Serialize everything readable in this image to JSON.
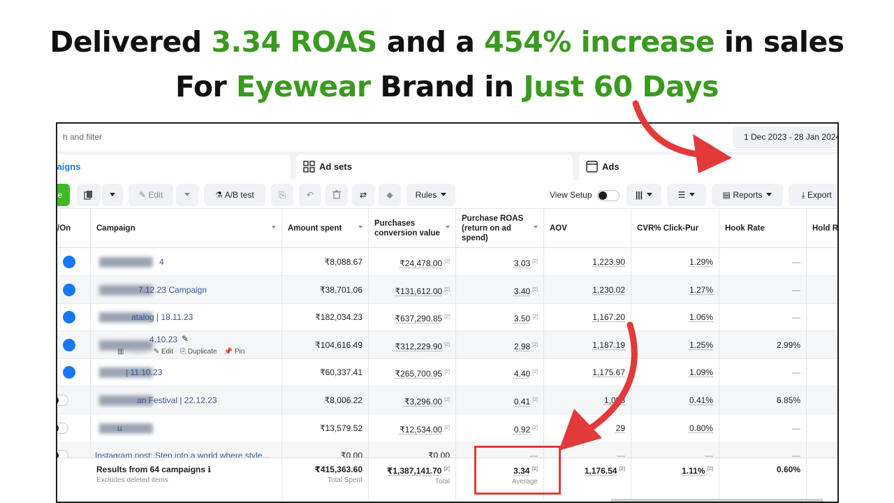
{
  "headline": {
    "line1": [
      "Delivered ",
      "3.34 ROAS",
      " and a ",
      "454% increase",
      " in sales"
    ],
    "line2": [
      "For ",
      "Eyewear",
      " Brand in ",
      "Just 60 Days"
    ]
  },
  "search": {
    "placeholder": "h and filter"
  },
  "date_range": "1 Dec 2023 - 28 Jan 2024",
  "tabs": {
    "campaigns": "mpaigns",
    "adsets": "Ad sets",
    "ads": "Ads"
  },
  "toolbar": {
    "create": "e",
    "edit": "Edit",
    "ab_test": "A/B test",
    "rules": "Rules",
    "view_setup": "View Setup",
    "reports": "Reports",
    "export": "Export"
  },
  "columns": {
    "onoff": "/On",
    "campaign": "Campaign",
    "amount_spent": "Amount spent",
    "purchases_value": "Purchases conversion value",
    "purchase_roas": "Purchase ROAS (return on ad spend)",
    "aov": "AOV",
    "cvr": "CVR% Click-Pur",
    "hook_rate": "Hook Rate",
    "hold_rate": "Hold R"
  },
  "rows": [
    {
      "on": true,
      "name": "4",
      "spent": "₹8,088.67",
      "value": "₹24,478.00",
      "roas": "3.03",
      "aov": "1,223.90",
      "cvr": "1.29%",
      "hook": "—"
    },
    {
      "on": true,
      "name": "7.12.23 Campaign",
      "spent": "₹38,701.06",
      "value": "₹131,612.00",
      "roas": "3.40",
      "aov": "1,230.02",
      "cvr": "1.27%",
      "hook": "—"
    },
    {
      "on": true,
      "name": "atalog | 18.11.23",
      "spent": "₹182,034.23",
      "value": "₹637,290.85",
      "roas": "3.50",
      "aov": "1,167.20",
      "cvr": "1.06%",
      "hook": "—"
    },
    {
      "on": true,
      "name": "4.10.23",
      "spent": "₹104,616.49",
      "value": "₹312,229.90",
      "roas": "2.98",
      "aov": "1,187.19",
      "cvr": "1.25%",
      "hook": "2.99%"
    },
    {
      "on": true,
      "name": "| 11.10.23",
      "spent": "₹60,337.41",
      "value": "₹265,700.95",
      "roas": "4.40",
      "aov": "1,175.67",
      "cvr": "1.09%",
      "hook": "—"
    },
    {
      "on": false,
      "name": "an Festival | 22.12.23",
      "spent": "₹8,006.22",
      "value": "₹3,296.00",
      "roas": "0.41",
      "aov": "1,098",
      "cvr": "0.41%",
      "hook": "6.85%"
    },
    {
      "on": false,
      "name": "u",
      "spent": "₹13,579.52",
      "value": "₹12,534.00",
      "roas": "0.92",
      "aov": "29",
      "cvr": "0.80%",
      "hook": "—"
    },
    {
      "on": false,
      "name": "Instagram post: Step into a world where style...",
      "spent": "₹0.00",
      "value": "₹0.00",
      "roas": "—",
      "aov": "—",
      "cvr": "—",
      "hook": "—"
    }
  ],
  "row_actions": {
    "edit": "Edit",
    "duplicate": "Duplicate",
    "pin": "Pin",
    "charts": "Charts"
  },
  "sup_marker": "[2]",
  "totals": {
    "label": "Results from 64 campaigns",
    "sublabel": "Excludes deleted items",
    "spent": "₹415,363.60",
    "spent_sub": "Total Spent",
    "value": "₹1,387,141.70",
    "value_sub": "Total",
    "roas": "3.34",
    "roas_sub": "Average",
    "aov": "1,176.54",
    "cvr": "1.11%",
    "hook": "0.60%"
  },
  "colors": {
    "accent_green": "#3a9a1f",
    "fb_blue": "#1877f2",
    "annotation_red": "#e23a3a"
  }
}
